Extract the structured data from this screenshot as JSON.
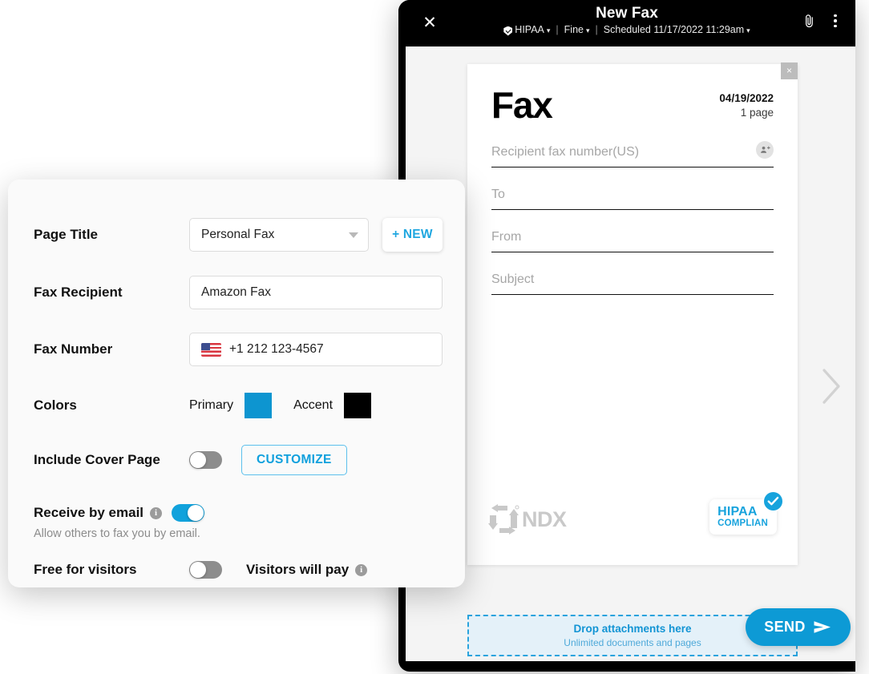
{
  "fax_window": {
    "close_icon": "close-icon",
    "title": "New Fax",
    "meta": {
      "hipaa": "HIPAA",
      "quality": "Fine",
      "schedule": "Scheduled 11/17/2022 11:29am",
      "separator": "|"
    },
    "attach_icon": "paperclip-icon",
    "more_icon": "kebab-menu-icon",
    "next_page_icon": "chevron-right-icon"
  },
  "paper": {
    "close_label": "×",
    "heading": "Fax",
    "date": "04/19/2022",
    "pages": "1 page",
    "fields": [
      {
        "name": "recipient-fax-number",
        "placeholder": "Recipient fax number(US)",
        "value": "",
        "has_contact_icon": true
      },
      {
        "name": "to",
        "placeholder": "To",
        "value": "",
        "has_contact_icon": false
      },
      {
        "name": "from",
        "placeholder": "From",
        "value": "",
        "has_contact_icon": false
      },
      {
        "name": "subject",
        "placeholder": "Subject",
        "value": "",
        "has_contact_icon": false
      }
    ],
    "logo_text": "NDX",
    "badge_line1": "HIPAA",
    "badge_line2": "COMPLIAN"
  },
  "dropzone": {
    "title": "Drop attachments here",
    "subtitle": "Unlimited documents and pages"
  },
  "send_button": {
    "label": "SEND",
    "icon": "send-arrow-icon"
  },
  "settings": {
    "page_title": {
      "label": "Page Title",
      "selected": "Personal Fax",
      "new_button": "+ NEW"
    },
    "fax_recipient": {
      "label": "Fax Recipient",
      "value": "Amazon Fax"
    },
    "fax_number": {
      "label": "Fax Number",
      "value": "+1 212 123-4567",
      "country_flag": "us-flag-icon"
    },
    "colors": {
      "label": "Colors",
      "primary_label": "Primary",
      "primary_color": "#0d95d0",
      "accent_label": "Accent",
      "accent_color": "#000000"
    },
    "cover_page": {
      "label": "Include Cover Page",
      "toggle_state": "off",
      "customize_button": "CUSTOMIZE"
    },
    "receive_by_email": {
      "label": "Receive by email",
      "toggle_state": "on",
      "helper": "Allow others to fax you by email.",
      "info_icon": "info-icon"
    },
    "free_for_visitors": {
      "label": "Free for visitors",
      "toggle_state": "off",
      "pay_label": "Visitors will pay",
      "info_icon": "info-icon"
    }
  }
}
